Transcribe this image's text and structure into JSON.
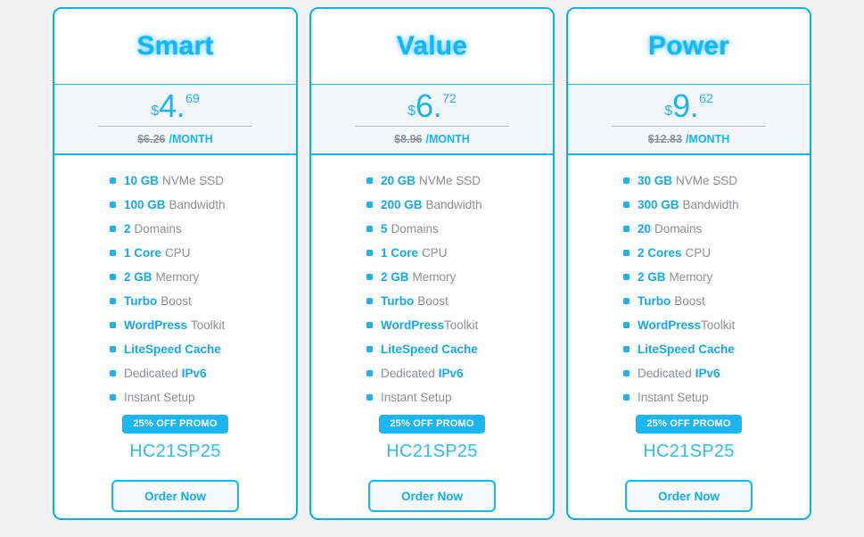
{
  "theme": {
    "accent": "#00b2f0",
    "accent_text": "#14b6f5",
    "muted_text": "#8b8e92",
    "page_background": "#f2f2f2",
    "price_band_background": "#f5f7fa"
  },
  "plans": [
    {
      "name": "Smart",
      "currency": "$",
      "price_int": "4.",
      "price_cents": "69",
      "old_price": "$6.26",
      "period": "/MONTH",
      "features": [
        {
          "strong": "10 GB",
          "plain": "NVMe SSD",
          "order": "strong-first",
          "gap": true
        },
        {
          "strong": "100 GB",
          "plain": "Bandwidth",
          "order": "strong-first",
          "gap": true
        },
        {
          "strong": "2",
          "plain": "Domains",
          "order": "strong-first",
          "gap": true
        },
        {
          "strong": "1 Core",
          "plain": "CPU",
          "order": "strong-first",
          "gap": true
        },
        {
          "strong": "2 GB",
          "plain": "Memory",
          "order": "strong-first",
          "gap": true
        },
        {
          "strong": "Turbo",
          "plain": "Boost",
          "order": "strong-first",
          "gap": true
        },
        {
          "strong": "WordPress",
          "plain": "Toolkit",
          "order": "strong-first",
          "gap": true
        },
        {
          "strong": "LiteSpeed Cache",
          "plain": "",
          "order": "strong-first",
          "gap": false
        },
        {
          "strong": "IPv6",
          "plain": "Dedicated",
          "order": "plain-first",
          "gap": true
        },
        {
          "strong": "",
          "plain": "Instant Setup",
          "order": "plain-first",
          "gap": false
        }
      ],
      "promo_badge": "25% OFF PROMO",
      "promo_code": "HC21SP25",
      "cta_label": "Order Now"
    },
    {
      "name": "Value",
      "currency": "$",
      "price_int": "6.",
      "price_cents": "72",
      "old_price": "$8.96",
      "period": "/MONTH",
      "features": [
        {
          "strong": "20 GB",
          "plain": "NVMe SSD",
          "order": "strong-first",
          "gap": true
        },
        {
          "strong": "200 GB",
          "plain": "Bandwidth",
          "order": "strong-first",
          "gap": true
        },
        {
          "strong": "5",
          "plain": "Domains",
          "order": "strong-first",
          "gap": true
        },
        {
          "strong": "1 Core",
          "plain": "CPU",
          "order": "strong-first",
          "gap": true
        },
        {
          "strong": "2 GB",
          "plain": "Memory",
          "order": "strong-first",
          "gap": true
        },
        {
          "strong": "Turbo",
          "plain": "Boost",
          "order": "strong-first",
          "gap": true
        },
        {
          "strong": "WordPress",
          "plain": "Toolkit",
          "order": "strong-first",
          "gap": false
        },
        {
          "strong": "LiteSpeed Cache",
          "plain": "",
          "order": "strong-first",
          "gap": false
        },
        {
          "strong": "IPv6",
          "plain": "Dedicated",
          "order": "plain-first",
          "gap": true
        },
        {
          "strong": "",
          "plain": "Instant Setup",
          "order": "plain-first",
          "gap": false
        }
      ],
      "promo_badge": "25% OFF PROMO",
      "promo_code": "HC21SP25",
      "cta_label": "Order Now"
    },
    {
      "name": "Power",
      "currency": "$",
      "price_int": "9.",
      "price_cents": "62",
      "old_price": "$12.83",
      "period": "/MONTH",
      "features": [
        {
          "strong": "30 GB",
          "plain": "NVMe SSD",
          "order": "strong-first",
          "gap": true
        },
        {
          "strong": "300 GB",
          "plain": "Bandwidth",
          "order": "strong-first",
          "gap": true
        },
        {
          "strong": "20",
          "plain": "Domains",
          "order": "strong-first",
          "gap": true
        },
        {
          "strong": "2 Cores",
          "plain": "CPU",
          "order": "strong-first",
          "gap": true
        },
        {
          "strong": "2 GB",
          "plain": "Memory",
          "order": "strong-first",
          "gap": true
        },
        {
          "strong": "Turbo",
          "plain": "Boost",
          "order": "strong-first",
          "gap": true
        },
        {
          "strong": "WordPress",
          "plain": "Toolkit",
          "order": "strong-first",
          "gap": false
        },
        {
          "strong": "LiteSpeed Cache",
          "plain": "",
          "order": "strong-first",
          "gap": false
        },
        {
          "strong": "IPv6",
          "plain": "Dedicated",
          "order": "plain-first",
          "gap": true
        },
        {
          "strong": "",
          "plain": "Instant Setup",
          "order": "plain-first",
          "gap": false
        }
      ],
      "promo_badge": "25% OFF PROMO",
      "promo_code": "HC21SP25",
      "cta_label": "Order Now"
    }
  ]
}
